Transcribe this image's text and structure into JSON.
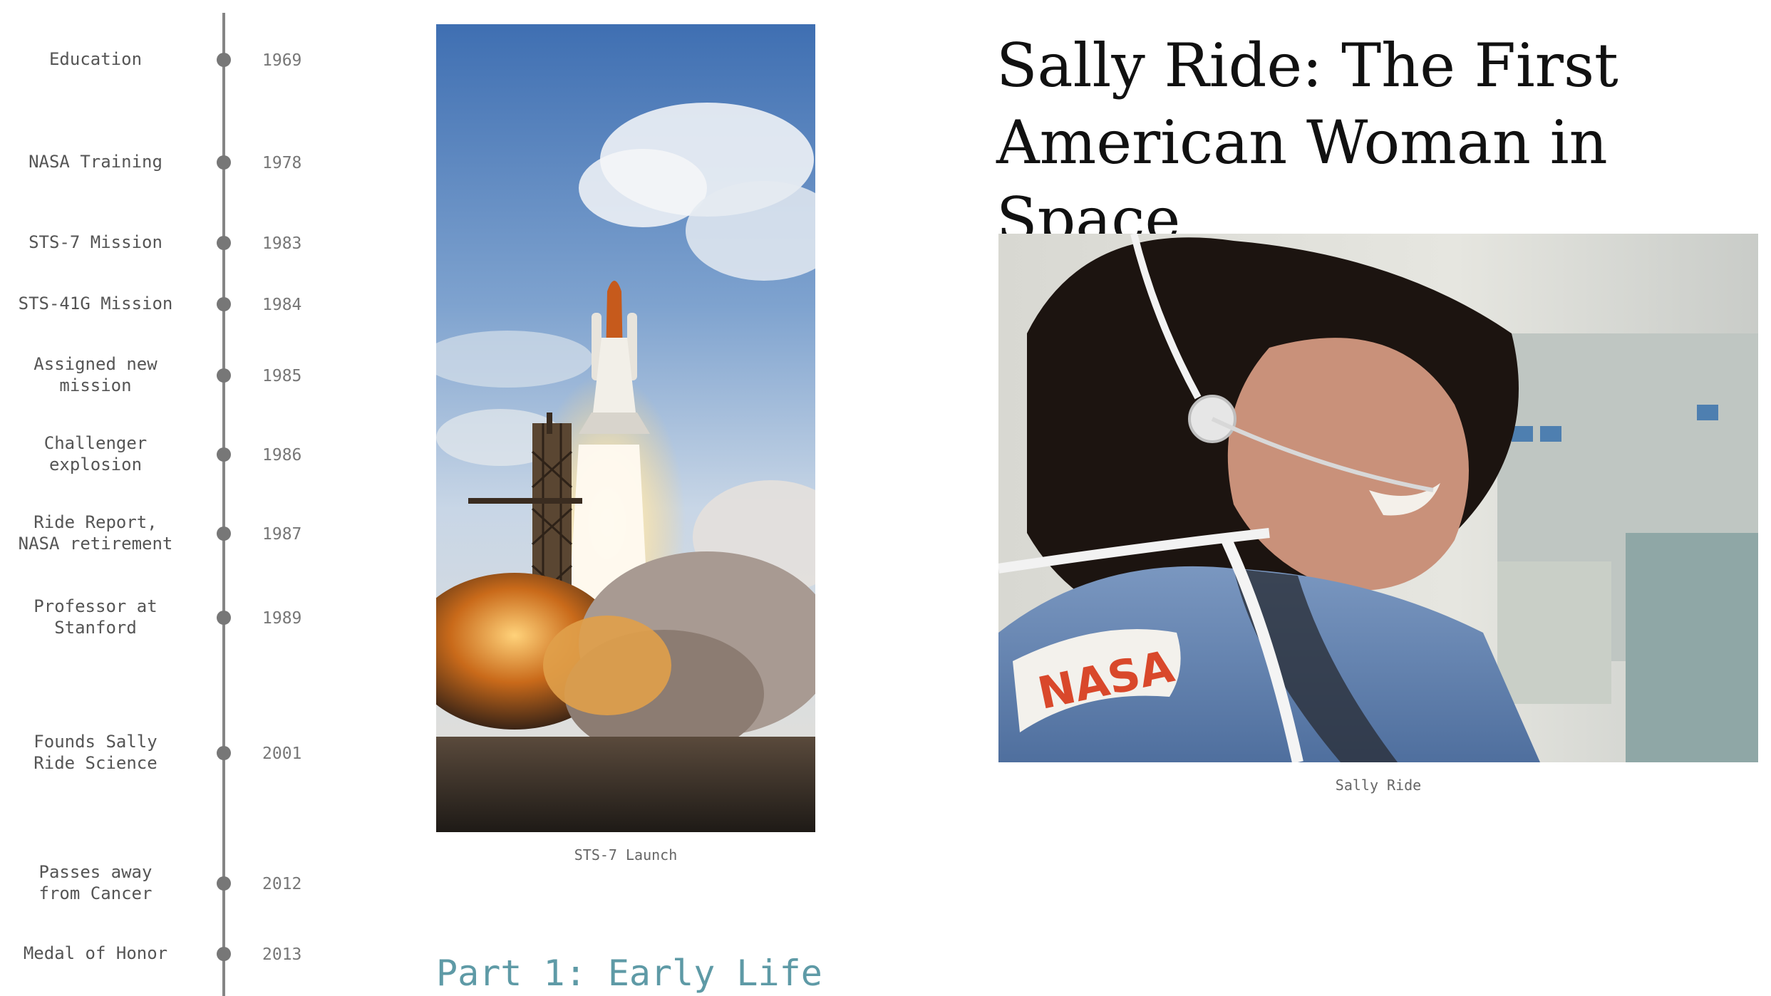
{
  "timeline": {
    "events": [
      {
        "label": "Education",
        "year": "1969"
      },
      {
        "label": "NASA Training",
        "year": "1978"
      },
      {
        "label": "STS-7 Mission",
        "year": "1983"
      },
      {
        "label": "STS-41G Mission",
        "year": "1984"
      },
      {
        "label": "Assigned new\nmission",
        "year": "1985"
      },
      {
        "label": "Challenger\nexplosion",
        "year": "1986"
      },
      {
        "label": "Ride Report,\nNASA retirement",
        "year": "1987"
      },
      {
        "label": "Professor at\nStanford",
        "year": "1989"
      },
      {
        "label": "Founds Sally\nRide Science",
        "year": "2001"
      },
      {
        "label": "Passes away\nfrom Cancer",
        "year": "2012"
      },
      {
        "label": "Medal of Honor",
        "year": "2013"
      }
    ]
  },
  "launch": {
    "caption": "STS-7 Launch"
  },
  "section": {
    "heading": "Part 1: Early Life"
  },
  "page": {
    "title": "Sally Ride: The First American Woman in Space"
  },
  "portrait": {
    "caption": "Sally Ride",
    "patch_text": "NASA"
  },
  "colors": {
    "timeline_line": "#858585",
    "section_heading": "#5e9aa6",
    "caption_text": "#666666",
    "nasa_red": "#d9482b"
  }
}
